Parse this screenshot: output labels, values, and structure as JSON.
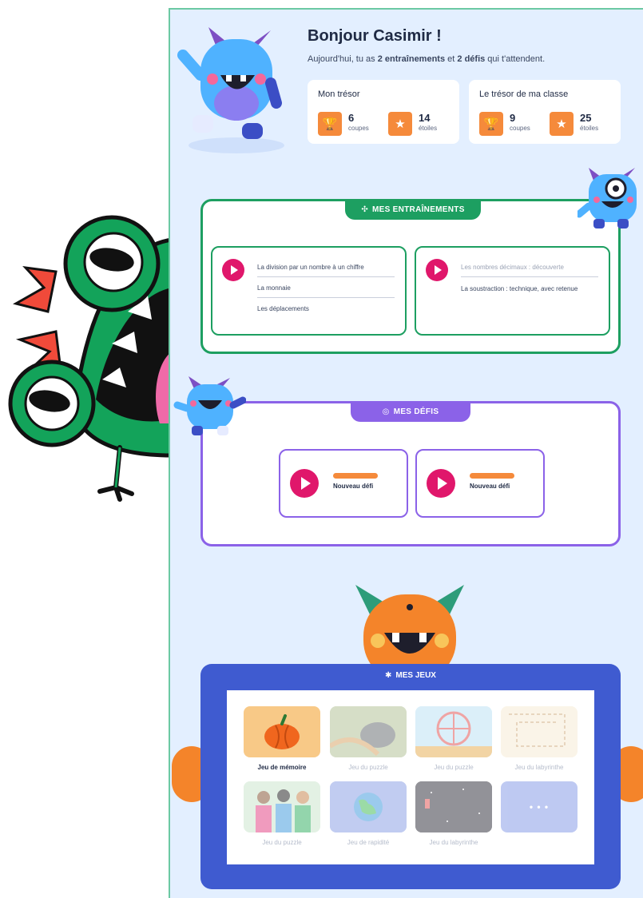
{
  "greeting": {
    "title": "Bonjour Casimir !",
    "sub_pre": "Aujourd'hui, tu as ",
    "sub_b1": "2 entraînements",
    "sub_mid": " et ",
    "sub_b2": "2 défis",
    "sub_post": " qui t'attendent."
  },
  "tresor": {
    "title": "Mon trésor",
    "coupes_value": "6",
    "coupes_unit": "coupes",
    "etoiles_value": "14",
    "etoiles_unit": "étoiles"
  },
  "tresor_classe": {
    "title": "Le trésor de ma classe",
    "coupes_value": "9",
    "coupes_unit": "coupes",
    "etoiles_value": "25",
    "etoiles_unit": "étoiles"
  },
  "entrainements": {
    "tab_label": "MES ENTRAÎNEMENTS",
    "card1": [
      "La division par un nombre à un chiffre",
      "La monnaie",
      "Les déplacements"
    ],
    "card2": [
      "Les nombres décimaux : découverte",
      "La soustraction : technique, avec retenue"
    ]
  },
  "defis": {
    "tab_label": "MES DÉFIS",
    "card1_label": "Nouveau défi",
    "card2_label": "Nouveau défi"
  },
  "jeux": {
    "tab_label": "MES JEUX",
    "games": [
      "Jeu de mémoire",
      "Jeu du puzzle",
      "Jeu du puzzle",
      "Jeu du labyrinthe",
      "Jeu du puzzle",
      "Jeu de rapidité",
      "Jeu du labyrinthe"
    ],
    "more_label": "• • •"
  },
  "colors": {
    "accent_green": "#1d9f61",
    "accent_purple": "#8b62e8",
    "accent_blue": "#3f5bd0",
    "play_pink": "#e0176b",
    "trophy_orange": "#f58a3b",
    "page_bg": "#e3efff"
  },
  "icons": [
    "trophy-icon",
    "star-icon",
    "play-icon",
    "target-icon",
    "puzzle-icon"
  ]
}
